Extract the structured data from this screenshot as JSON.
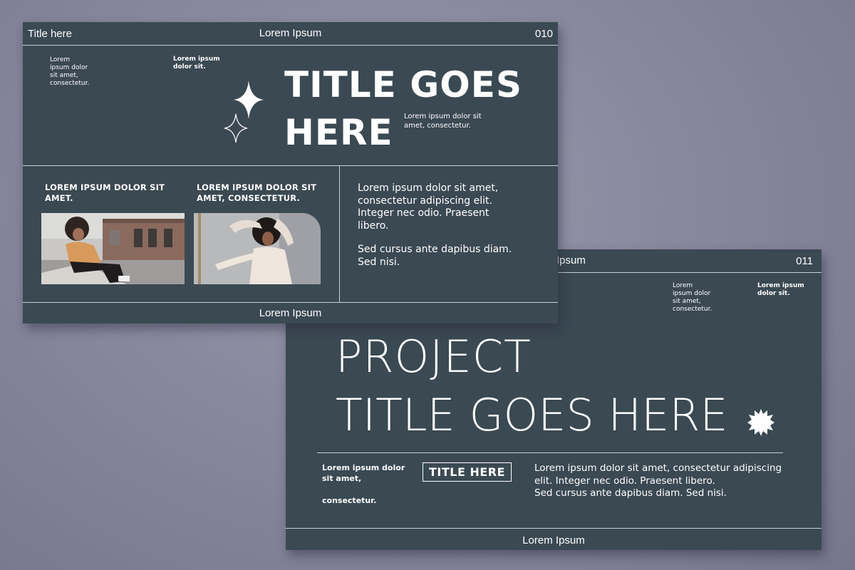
{
  "slide1": {
    "header_left": "Title here",
    "header_center": "Lorem Ipsum",
    "page_number": "010",
    "top_left_text": [
      "Lorem",
      "ipsum dolor",
      "sit amet,",
      "consectetur."
    ],
    "top_mid_text": [
      "Lorem ipsum",
      "dolor sit."
    ],
    "title_line1": "TITLE GOES",
    "title_line2": "HERE",
    "title_side_text": [
      "Lorem ipsum dolor sit",
      "amet, consectetur."
    ],
    "col1_heading": [
      "LOREM IPSUM DOLOR SIT",
      "AMET."
    ],
    "col2_heading": [
      "LOREM IPSUM DOLOR SIT",
      "AMET, CONSECTETUR."
    ],
    "right_paragraph1": [
      "Lorem ipsum dolor sit amet,",
      "consectetur adipiscing elit.",
      "Integer nec odio. Praesent",
      "libero."
    ],
    "right_paragraph2": [
      "Sed cursus ante dapibus diam.",
      "Sed nisi."
    ],
    "footer_center": "Lorem Ipsum"
  },
  "slide2": {
    "header_center_partial": "Ipsum",
    "page_number": "011",
    "top_text_a": [
      "Lorem",
      "ipsum dolor",
      "sit amet,",
      "consectetur."
    ],
    "top_text_b": [
      "Lorem ipsum",
      "dolor sit."
    ],
    "title_line1": "PROJECT",
    "title_line2": "TITLE GOES HERE",
    "left_text_line1": "Lorem ipsum dolor",
    "left_text_line2": "sit amet,",
    "left_text_line3": "consectetur.",
    "boxed_title": "TITLE HERE",
    "right_text": [
      "Lorem ipsum dolor sit amet, consectetur adipiscing",
      "elit. Integer nec odio. Praesent libero.",
      "Sed cursus ante dapibus diam. Sed nisi."
    ],
    "footer_center": "Lorem Ipsum"
  },
  "colors": {
    "slide_bg": "#3a4952",
    "text": "#ffffff",
    "rule": "#c9d0d4",
    "page_bg": "#8a899f"
  },
  "icons": {
    "sparkle": "four-point-star-icon",
    "burst": "starburst-icon"
  }
}
